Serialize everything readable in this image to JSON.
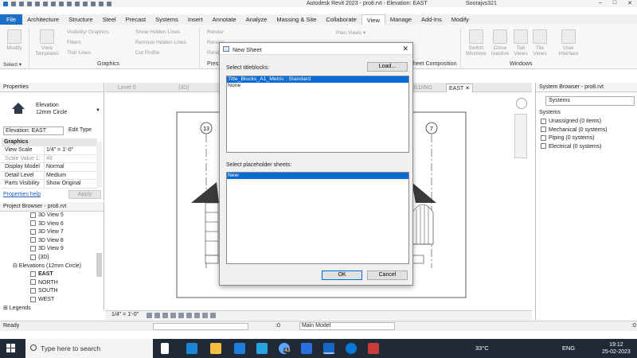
{
  "window": {
    "title": "Autodesk Revit 2023 - pro8.rvt - Elevation: EAST",
    "user": "Soorajvs321",
    "controls": [
      "–",
      "□",
      "✕"
    ]
  },
  "ribbon_tabs": [
    "File",
    "Architecture",
    "Structure",
    "Steel",
    "Precast",
    "Systems",
    "Insert",
    "Annotate",
    "Analyze",
    "Massing & Site",
    "Collaborate",
    "View",
    "Manage",
    "Add-Ins",
    "Modify"
  ],
  "active_tab": "View",
  "ribbon": {
    "modify": "Modify",
    "select": "Select ▾",
    "view_templates": "View Templates",
    "visibility_graphics": "Visibility/ Graphics",
    "filters": "Filters",
    "thin_lines": "Thin  Lines",
    "show_hidden_lines": "Show  Hidden Lines",
    "remove_hidden_lines": "Remove  Hidden Lines",
    "cut_profile": "Cut  Profile",
    "render": "Render",
    "render2": "Render",
    "render_gallery": "Render Gallery",
    "plan_views": "Plan  Views ▾",
    "graphics_group": "Graphics",
    "pres_group": "Pres",
    "sheet_composition": "heet Composition",
    "switch_windows": "Switch Windows",
    "close_inactive": "Close Inactive",
    "tab_views": "Tab Views",
    "tile_views": "Tile Views",
    "user_interface": "User Interface",
    "windows_group": "Windows"
  },
  "properties": {
    "title": "Properties",
    "type_name": "Elevation",
    "type_sub": "12mm Circle",
    "selector": "Elevation: EAST",
    "edit_type": "Edit Type",
    "section": "Graphics",
    "rows": [
      {
        "k": "View Scale",
        "v": "1/4\" = 1'-0\"",
        "dim": false
      },
      {
        "k": "Scale Value  1:",
        "v": "48",
        "dim": true
      },
      {
        "k": "Display Model",
        "v": "Normal",
        "dim": false
      },
      {
        "k": "Detail Level",
        "v": "Medium",
        "dim": false
      },
      {
        "k": "Parts Visibility",
        "v": "Show Original",
        "dim": false
      }
    ],
    "help": "Properties help",
    "apply": "Apply"
  },
  "project_browser": {
    "title": "Project Browser - pro8.rvt",
    "items": [
      {
        "label": "3D View 5",
        "bold": false,
        "indent": 38,
        "box": true
      },
      {
        "label": "3D View 6",
        "bold": false,
        "indent": 38,
        "box": true
      },
      {
        "label": "3D View 7",
        "bold": false,
        "indent": 38,
        "box": true
      },
      {
        "label": "3D View 8",
        "bold": false,
        "indent": 38,
        "box": true
      },
      {
        "label": "3D View 9",
        "bold": false,
        "indent": 38,
        "box": true
      },
      {
        "label": "{3D}",
        "bold": false,
        "indent": 38,
        "box": true
      },
      {
        "label": "⊟ Elevations (12mm Circle)",
        "bold": false,
        "indent": 16,
        "box": false
      },
      {
        "label": "EAST",
        "bold": true,
        "indent": 38,
        "box": true
      },
      {
        "label": "NORTH",
        "bold": false,
        "indent": 38,
        "box": true
      },
      {
        "label": "SOUTH",
        "bold": false,
        "indent": 38,
        "box": true
      },
      {
        "label": "WEST",
        "bold": false,
        "indent": 38,
        "box": true
      },
      {
        "label": "⊞ Legends",
        "bold": false,
        "indent": 4,
        "box": false
      }
    ]
  },
  "view_tabs": {
    "level0": "Level 0",
    "threed": "{3D}",
    "building": "BUILDING",
    "east": "EAST"
  },
  "drawing": {
    "grid_left": "13",
    "grid_right": "7"
  },
  "view_control": {
    "scale": "1/4\" = 1'-0\""
  },
  "system_browser": {
    "title": "System Browser - pro8.rvt",
    "selector": "Systems",
    "header": "Systems",
    "items": [
      "Unassigned (0 items)",
      "Mechanical (0 systems)",
      "Piping (0 systems)",
      "Electrical (0 systems)"
    ]
  },
  "status": {
    "ready": "Ready",
    "zero": ":0",
    "model": "Main Model",
    "zero2": ":0"
  },
  "dialog": {
    "title": "New Sheet",
    "titleblocks_label": "Select titleblocks:",
    "load": "Load...",
    "titleblocks": [
      "Title_Blocks_A1_Metric : Standard",
      "None"
    ],
    "placeholder_label": "Select placeholder sheets:",
    "placeholders": [
      "New"
    ],
    "ok": "OK",
    "cancel": "Cancel"
  },
  "taskbar": {
    "search": "Type here to search",
    "badge": "43",
    "weather": "33°C",
    "lang": "ENG",
    "time": "19:12",
    "date": "25-02-2023"
  },
  "colors": {
    "file_tab": "#1e70c6",
    "selection": "#0a6ad6",
    "taskbar": "#202a36"
  }
}
